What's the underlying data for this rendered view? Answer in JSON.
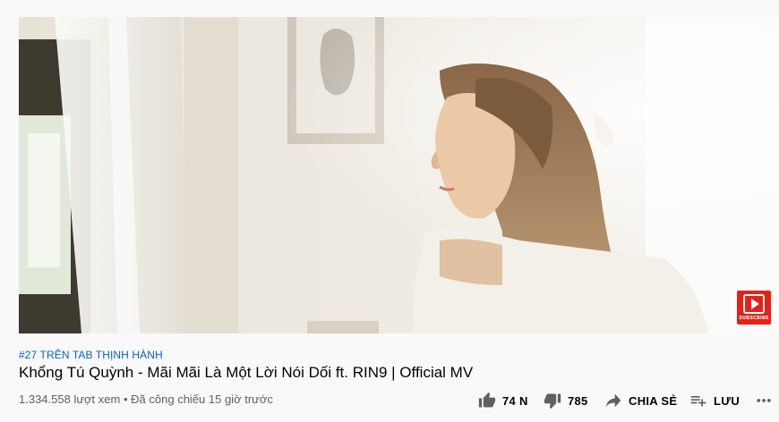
{
  "video": {
    "trending_tag": "#27 TRÊN TAB THỊNH HÀNH",
    "title": "Khổng Tú Quỳnh - Mãi Mãi Là Một Lời Nói Dối ft. RIN9 | Official MV",
    "views": "1.334.558 lượt xem",
    "separator": "•",
    "premiered": "Đã công chiếu 15 giờ trước",
    "watermark_label": "SUBSCRIBE"
  },
  "actions": {
    "like_count": "74 N",
    "dislike_count": "785",
    "share_label": "CHIA SẺ",
    "save_label": "LƯU"
  },
  "colors": {
    "link_blue": "#065fd4",
    "subscribe_red": "#e62117",
    "meta_gray": "#606060"
  },
  "icons": [
    "thumb-up-icon",
    "thumb-down-icon",
    "share-icon",
    "playlist-add-icon",
    "more-horiz-icon",
    "subscribe-play-icon"
  ]
}
